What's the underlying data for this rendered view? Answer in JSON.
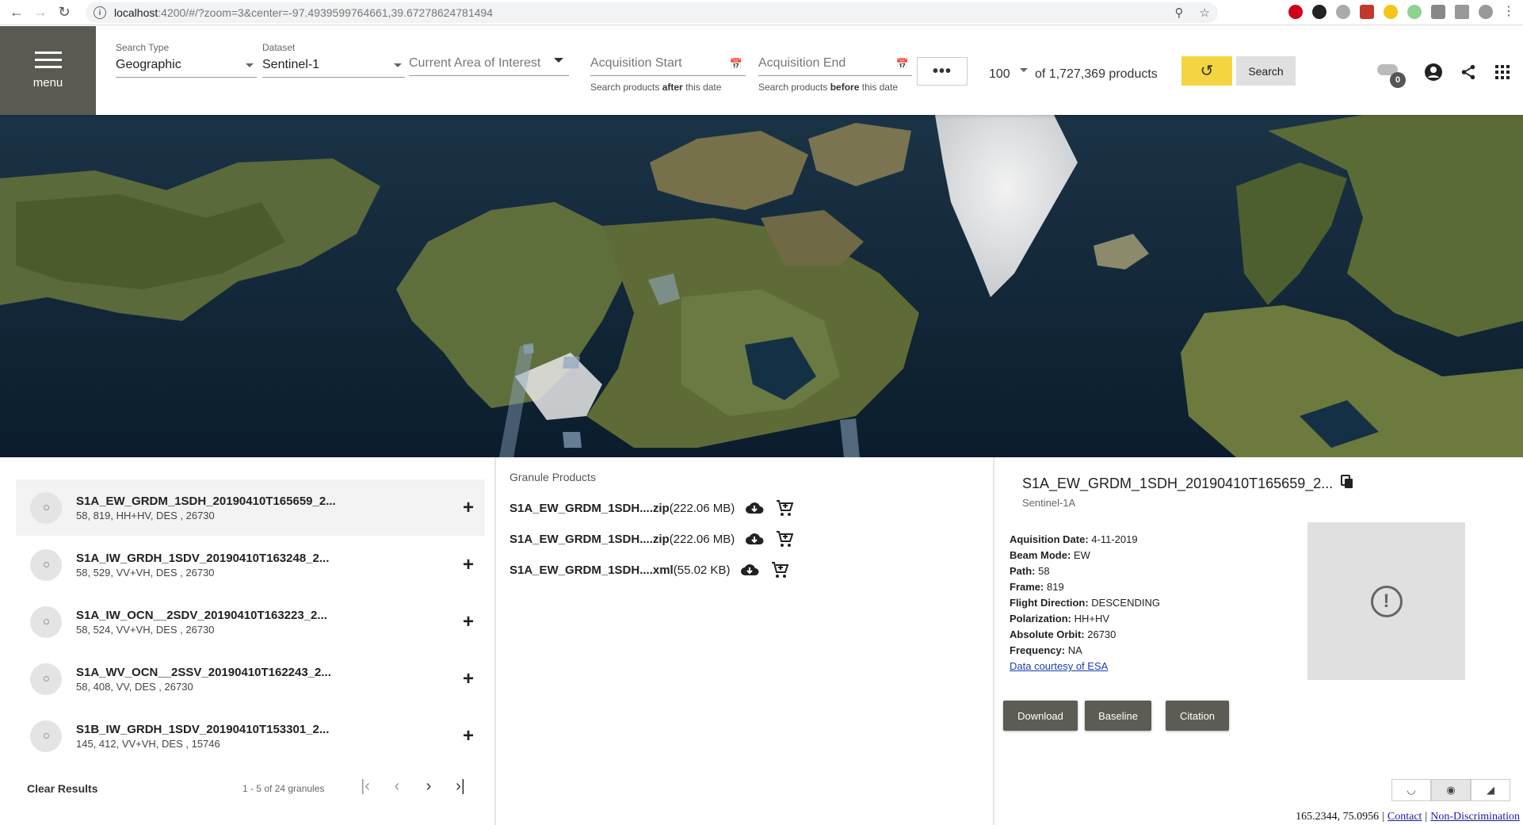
{
  "browser": {
    "url_host": "localhost",
    "url_rest": ":4200/#/?zoom=3&center=-97.4939599764661,39.67278624781494"
  },
  "menu": {
    "label": "menu"
  },
  "search": {
    "type_label": "Search Type",
    "type_value": "Geographic",
    "dataset_label": "Dataset",
    "dataset_value": "Sentinel-1",
    "aoi_placeholder": "Current Area of Interest",
    "start_placeholder": "Acquisition Start",
    "start_hint_pre": "Search products ",
    "start_hint_bold": "after",
    "start_hint_post": " this date",
    "end_placeholder": "Acquisition End",
    "end_hint_pre": "Search products ",
    "end_hint_bold": "before",
    "end_hint_post": " this date",
    "more_label": "•••",
    "max_results": "100",
    "count_text": "of 1,727,369 products",
    "search_label": "Search",
    "queue_count": "0"
  },
  "results": {
    "items": [
      {
        "name": "S1A_EW_GRDM_1SDH_20190410T165659_2...",
        "meta": "58, 819, HH+HV, DES , 26730"
      },
      {
        "name": "S1A_IW_GRDH_1SDV_20190410T163248_2...",
        "meta": "58, 529, VV+VH, DES , 26730"
      },
      {
        "name": "S1A_IW_OCN__2SDV_20190410T163223_2...",
        "meta": "58, 524, VV+VH, DES , 26730"
      },
      {
        "name": "S1A_WV_OCN__2SSV_20190410T162243_2...",
        "meta": "58, 408, VV, DES , 26730"
      },
      {
        "name": "S1B_IW_GRDH_1SDV_20190410T153301_2...",
        "meta": "145, 412, VV+VH, DES , 15746"
      }
    ],
    "clear_label": "Clear Results",
    "pager_text": "1 - 5 of 24 granules"
  },
  "files": {
    "title": "Granule Products",
    "items": [
      {
        "name": "S1A_EW_GRDM_1SDH....zip",
        "size": "(222.06 MB)"
      },
      {
        "name": "S1A_EW_GRDM_1SDH....zip",
        "size": "(222.06 MB)"
      },
      {
        "name": "S1A_EW_GRDM_1SDH....xml",
        "size": "(55.02 KB)"
      }
    ]
  },
  "detail": {
    "title": "S1A_EW_GRDM_1SDH_20190410T165659_2...",
    "subtitle": "Sentinel-1A",
    "props": [
      {
        "label": "Aquisition Date:",
        "value": "4-11-2019"
      },
      {
        "label": "Beam Mode:",
        "value": "EW"
      },
      {
        "label": "Path:",
        "value": "58"
      },
      {
        "label": "Frame:",
        "value": "819"
      },
      {
        "label": "Flight Direction:",
        "value": "DESCENDING"
      },
      {
        "label": "Polarization:",
        "value": "HH+HV"
      },
      {
        "label": "Absolute Orbit:",
        "value": "26730"
      },
      {
        "label": "Frequency:",
        "value": "NA"
      }
    ],
    "esa_link": "Data courtesy of ESA",
    "buttons": {
      "download": "Download",
      "baseline": "Baseline",
      "citation": "Citation"
    }
  },
  "footer": {
    "coords": "165.2344, 75.0956",
    "contact": "Contact",
    "nondisc": "Non-Discrimination"
  },
  "colors": {
    "menu_bg": "#5a5a52",
    "reset_btn": "#f5d442",
    "detail_btn": "#5c5c54",
    "link": "#1a3fb0"
  }
}
